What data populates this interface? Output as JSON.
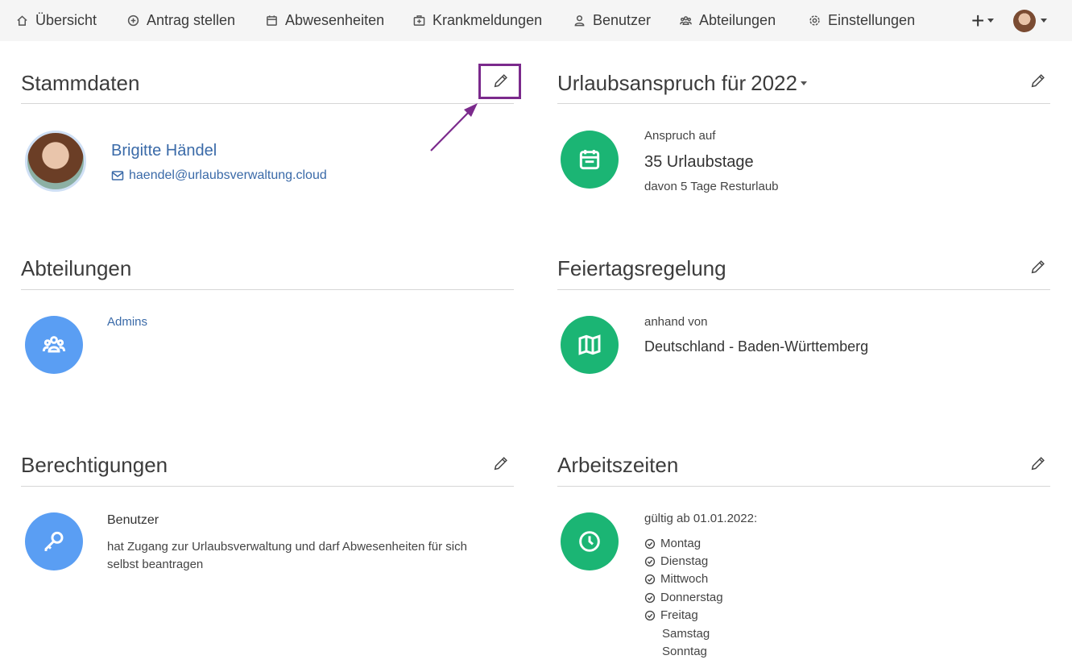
{
  "nav": {
    "items": [
      {
        "label": "Übersicht",
        "icon": "home-icon"
      },
      {
        "label": "Antrag stellen",
        "icon": "plus-circle-icon"
      },
      {
        "label": "Abwesenheiten",
        "icon": "calendar-icon"
      },
      {
        "label": "Krankmeldungen",
        "icon": "medical-bag-icon"
      },
      {
        "label": "Benutzer",
        "icon": "user-icon"
      },
      {
        "label": "Abteilungen",
        "icon": "users-group-icon"
      },
      {
        "label": "Einstellungen",
        "icon": "gear-icon"
      }
    ],
    "plus_label": "+"
  },
  "stammdaten": {
    "title": "Stammdaten",
    "name": "Brigitte Händel",
    "email": "haendel@urlaubsverwaltung.cloud"
  },
  "urlaubsanspruch": {
    "title": "Urlaubsanspruch für",
    "year": "2022",
    "caption": "Anspruch auf",
    "days": "35 Urlaubstage",
    "remaining": "davon 5 Tage Resturlaub"
  },
  "abteilungen": {
    "title": "Abteilungen",
    "items": [
      "Admins"
    ]
  },
  "feiertagsregelung": {
    "title": "Feiertagsregelung",
    "caption": "anhand von",
    "value": "Deutschland - Baden-Württemberg"
  },
  "berechtigungen": {
    "title": "Berechtigungen",
    "role": "Benutzer",
    "description_line1": "hat Zugang zur Urlaubsverwaltung und darf Abwesenheiten für sich",
    "description_line2": "selbst beantragen"
  },
  "arbeitszeiten": {
    "title": "Arbeitszeiten",
    "valid_from": "gültig ab 01.01.2022:",
    "days": [
      {
        "label": "Montag",
        "working": true
      },
      {
        "label": "Dienstag",
        "working": true
      },
      {
        "label": "Mittwoch",
        "working": true
      },
      {
        "label": "Donnerstag",
        "working": true
      },
      {
        "label": "Freitag",
        "working": true
      },
      {
        "label": "Samstag",
        "working": false
      },
      {
        "label": "Sonntag",
        "working": false
      }
    ]
  },
  "colors": {
    "green": "#1bb574",
    "blue": "#5a9ef3",
    "highlight": "#7b2a8c",
    "link": "#3a6aa8"
  }
}
